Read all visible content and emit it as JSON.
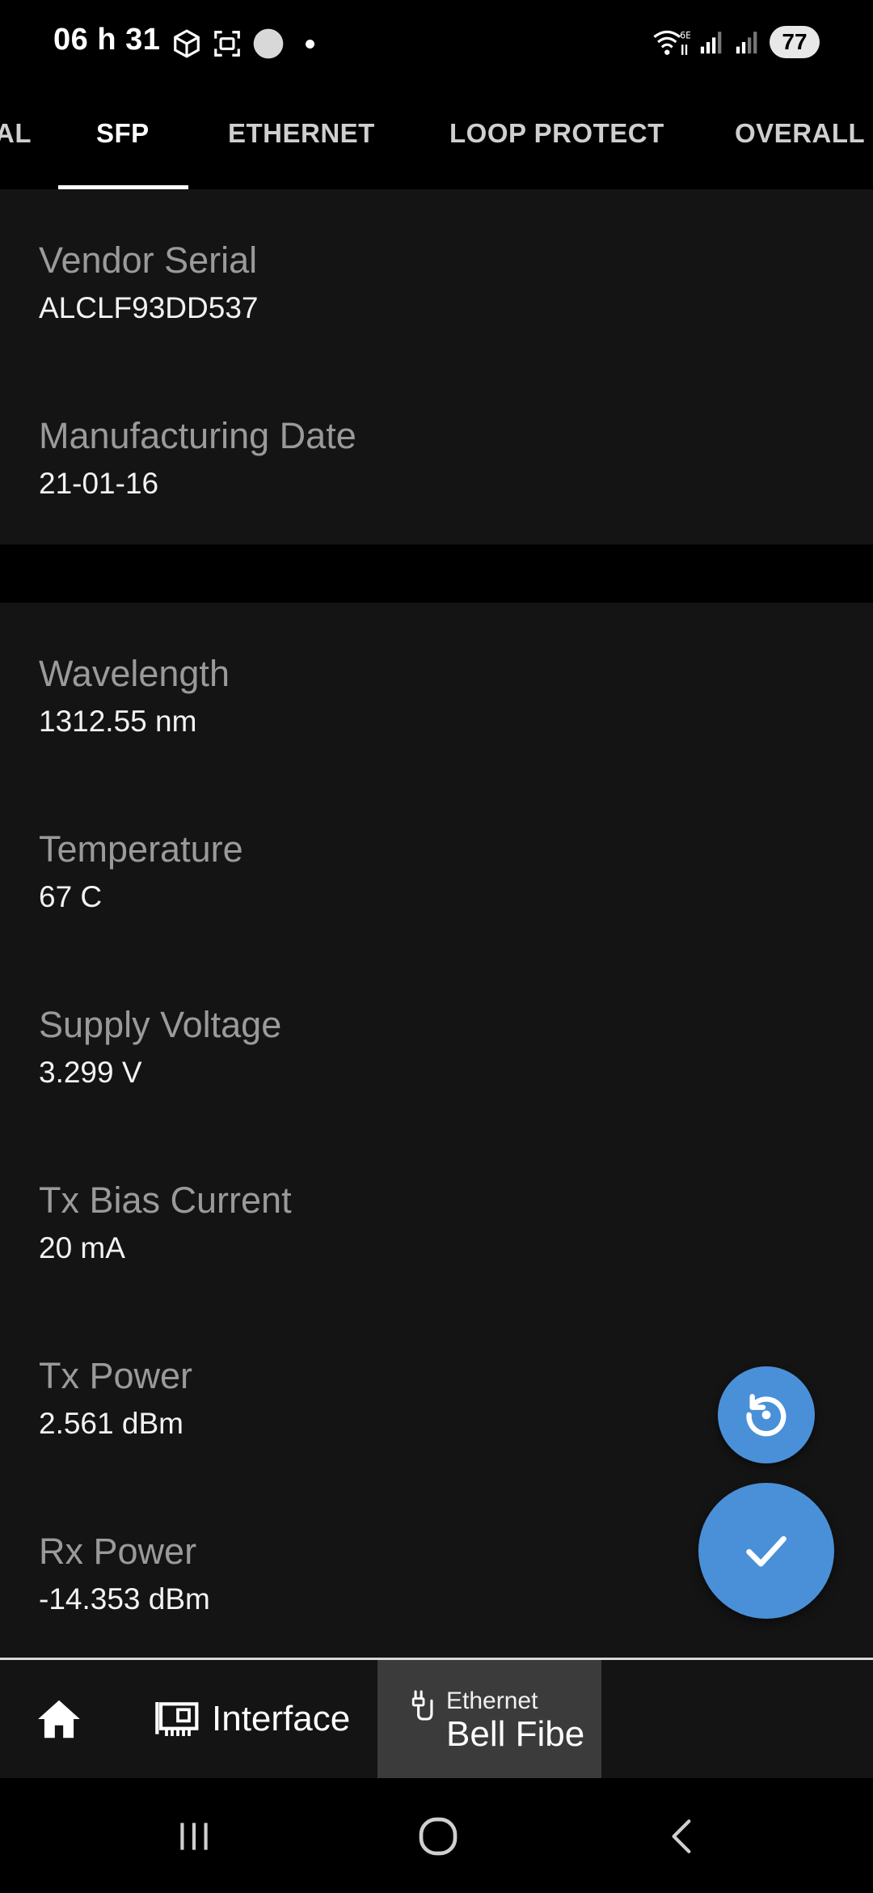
{
  "status_bar": {
    "time": "06 h 31",
    "battery": "77",
    "left_icons": [
      "cube-icon",
      "screenshot-icon",
      "circle-icon",
      "dot-icon"
    ],
    "right_icons": [
      "wifi-6e-icon",
      "signal-icon",
      "signal-icon"
    ]
  },
  "tabs": [
    {
      "label": "AL",
      "active": false
    },
    {
      "label": "SFP",
      "active": true
    },
    {
      "label": "ETHERNET",
      "active": false
    },
    {
      "label": "LOOP PROTECT",
      "active": false
    },
    {
      "label": "OVERALL S",
      "active": false
    }
  ],
  "sfp_info": [
    {
      "label": "Vendor Serial",
      "value": "ALCLF93DD537"
    },
    {
      "label": "Manufacturing Date",
      "value": "21-01-16"
    }
  ],
  "sfp_diagnostics": [
    {
      "label": "Wavelength",
      "value": "1312.55 nm"
    },
    {
      "label": "Temperature",
      "value": "67 C"
    },
    {
      "label": "Supply Voltage",
      "value": "3.299 V"
    },
    {
      "label": "Tx Bias Current",
      "value": "20 mA"
    },
    {
      "label": "Tx Power",
      "value": "2.561 dBm"
    },
    {
      "label": "Rx Power",
      "value": "-14.353 dBm"
    }
  ],
  "fabs": {
    "reset_icon": "restore-icon",
    "apply_icon": "check-icon"
  },
  "bottom_bar": {
    "home_icon": "home-icon",
    "interface_label": "Interface",
    "interface_icon": "network-card-icon",
    "ethernet_sub": "Ethernet",
    "ethernet_main": "Bell Fibe",
    "ethernet_icon": "ethernet-plug-icon"
  },
  "colors": {
    "accent": "#4a90d9",
    "background": "#141414",
    "label": "#9a9a9a"
  }
}
